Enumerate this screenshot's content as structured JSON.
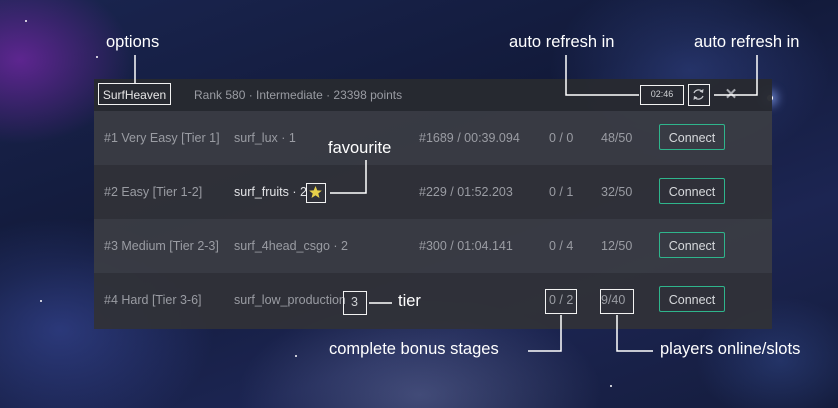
{
  "header": {
    "server_name": "SurfHeaven",
    "rank_info": "Rank 580 · Intermediate · 23398 points",
    "refresh_timer": "02:46",
    "close_glyph": "✕"
  },
  "servers": [
    {
      "tier_label": "#1 Very Easy [Tier 1]",
      "map": "surf_lux · 1",
      "record": "#1689 / 00:39.094",
      "bonus": "0 / 0",
      "players": "48/50",
      "connect": "Connect",
      "favourite": false
    },
    {
      "tier_label": "#2 Easy [Tier 1-2]",
      "map": "surf_fruits · 2",
      "record": "#229 / 01:52.203",
      "bonus": "0 / 1",
      "players": "32/50",
      "connect": "Connect",
      "favourite": true
    },
    {
      "tier_label": "#3 Medium [Tier 2-3]",
      "map": "surf_4head_csgo · 2",
      "record": "#300 / 01:04.141",
      "bonus": "0 / 4",
      "players": "12/50",
      "connect": "Connect",
      "favourite": false
    },
    {
      "tier_label": "#4 Hard [Tier 3-6]",
      "map": "surf_low_production",
      "map_tier": "3",
      "record": "",
      "bonus": "0 / 2",
      "players": "9/40",
      "connect": "Connect",
      "favourite": false
    }
  ],
  "annotations": {
    "options": "options",
    "auto_refresh_timer": "auto refresh in",
    "auto_refresh_button": "auto refresh in",
    "favourite": "favourite",
    "tier": "tier",
    "bonus_stages": "complete bonus stages",
    "players": "players online/slots"
  },
  "colors": {
    "connect_border": "#2fb58c",
    "favourite_star": "#e6cf4a",
    "annotation": "#ffffff"
  },
  "icons": [
    "refresh-icon",
    "close-icon",
    "star-icon"
  ]
}
